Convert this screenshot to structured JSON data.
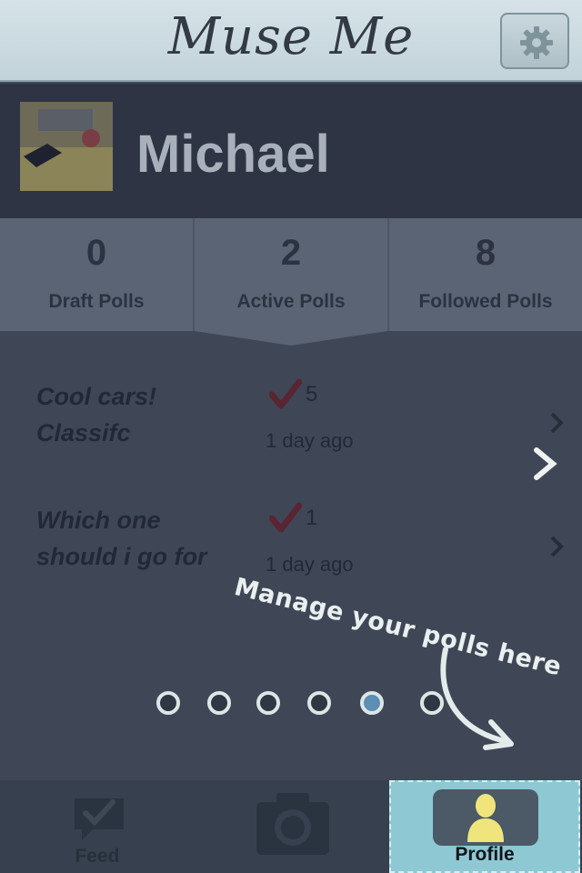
{
  "app": {
    "title": "Muse Me"
  },
  "header": {
    "settings_icon": "gear-icon"
  },
  "profile": {
    "name": "Michael"
  },
  "stats": [
    {
      "value": "0",
      "label": "Draft Polls"
    },
    {
      "value": "2",
      "label": "Active Polls"
    },
    {
      "value": "8",
      "label": "Followed Polls"
    }
  ],
  "polls": [
    {
      "title_line1": "Cool cars!",
      "title_line2": "Classifc",
      "votes": "5",
      "age": "1 day ago"
    },
    {
      "title_line1": "Which one",
      "title_line2": "should i go for",
      "votes": "1",
      "age": "1 day ago"
    }
  ],
  "tutorial": {
    "text": "Manage your polls here",
    "total_pages": 6,
    "current_page": 5
  },
  "tabs": [
    {
      "label": "Feed",
      "icon": "chat-check-icon"
    },
    {
      "label": "",
      "icon": "camera-icon"
    },
    {
      "label": "Profile",
      "icon": "person-icon",
      "selected": true
    }
  ],
  "colors": {
    "accent": "#8ec9d3",
    "background": "#3f4757",
    "active_dot": "#5b8fb3"
  }
}
